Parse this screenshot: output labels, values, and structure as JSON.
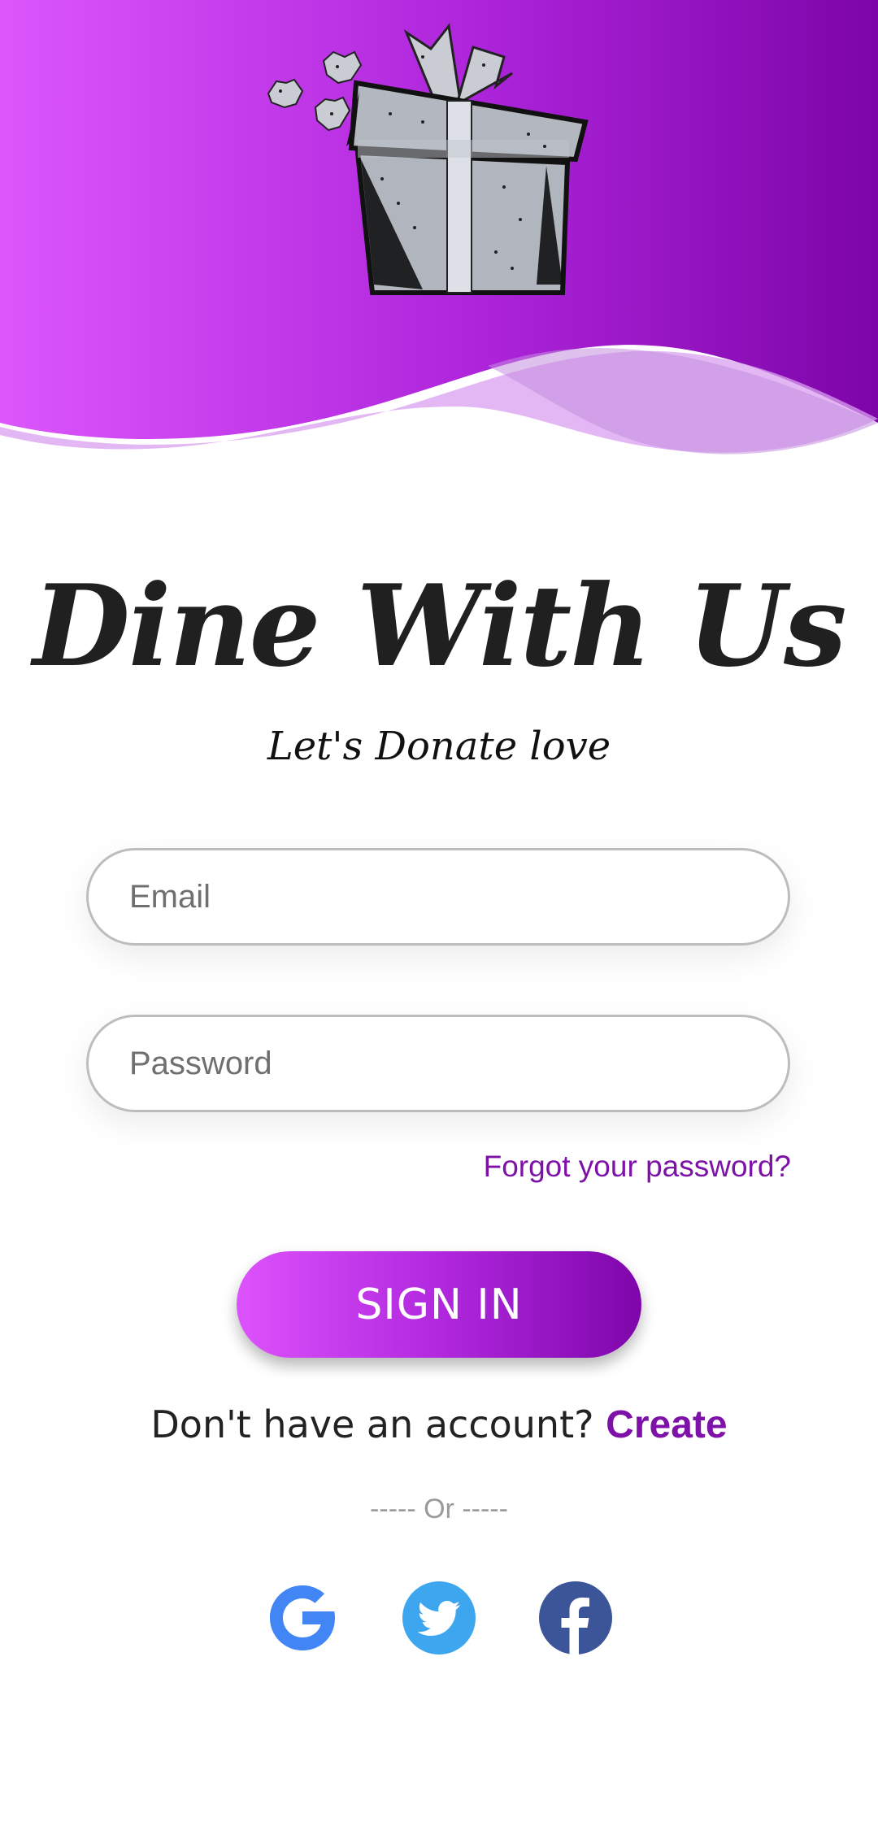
{
  "app": {
    "title": "Dine With Us",
    "tagline": "Let's Donate love"
  },
  "form": {
    "email_placeholder": "Email",
    "password_placeholder": "Password",
    "forgot_label": "Forgot your password?",
    "signin_label": "SIGN IN"
  },
  "signup": {
    "prompt": "Don't have an account?",
    "create_label": "Create"
  },
  "divider_text": "----- Or -----",
  "social": [
    {
      "icon": "google-icon"
    },
    {
      "icon": "twitter-icon"
    },
    {
      "icon": "facebook-icon"
    }
  ],
  "colors": {
    "gradient_start": "#dc52fb",
    "gradient_end": "#7e06aa",
    "accent_purple": "#7e12a8",
    "google_blue": "#4285f4",
    "twitter_blue": "#3da6ef",
    "facebook_blue": "#3b5598"
  }
}
